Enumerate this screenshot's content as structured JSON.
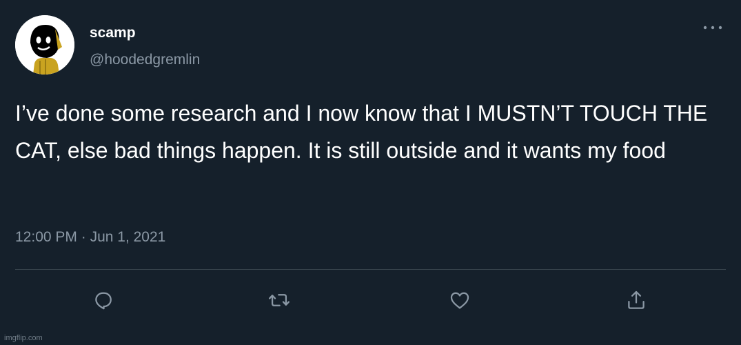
{
  "author": {
    "display_name": "scamp",
    "handle": "@hoodedgremlin",
    "avatar_icon": "hooded-figure-avatar"
  },
  "tweet": {
    "text": "I’ve done some research and I now know that I MUSTN’T TOUCH THE CAT, else bad things happen. It is still outside and it wants my food",
    "time": "12:00 PM",
    "separator": "·",
    "date": "Jun 1, 2021"
  },
  "actions": [
    {
      "name": "reply",
      "icon": "speech-bubble-icon"
    },
    {
      "name": "retweet",
      "icon": "retweet-icon"
    },
    {
      "name": "like",
      "icon": "heart-icon"
    },
    {
      "name": "share",
      "icon": "share-icon"
    }
  ],
  "watermark": "imgflip.com",
  "colors": {
    "background": "#15202b",
    "text": "#ffffff",
    "secondary_text": "#8b98a5",
    "divider": "#38444d"
  }
}
